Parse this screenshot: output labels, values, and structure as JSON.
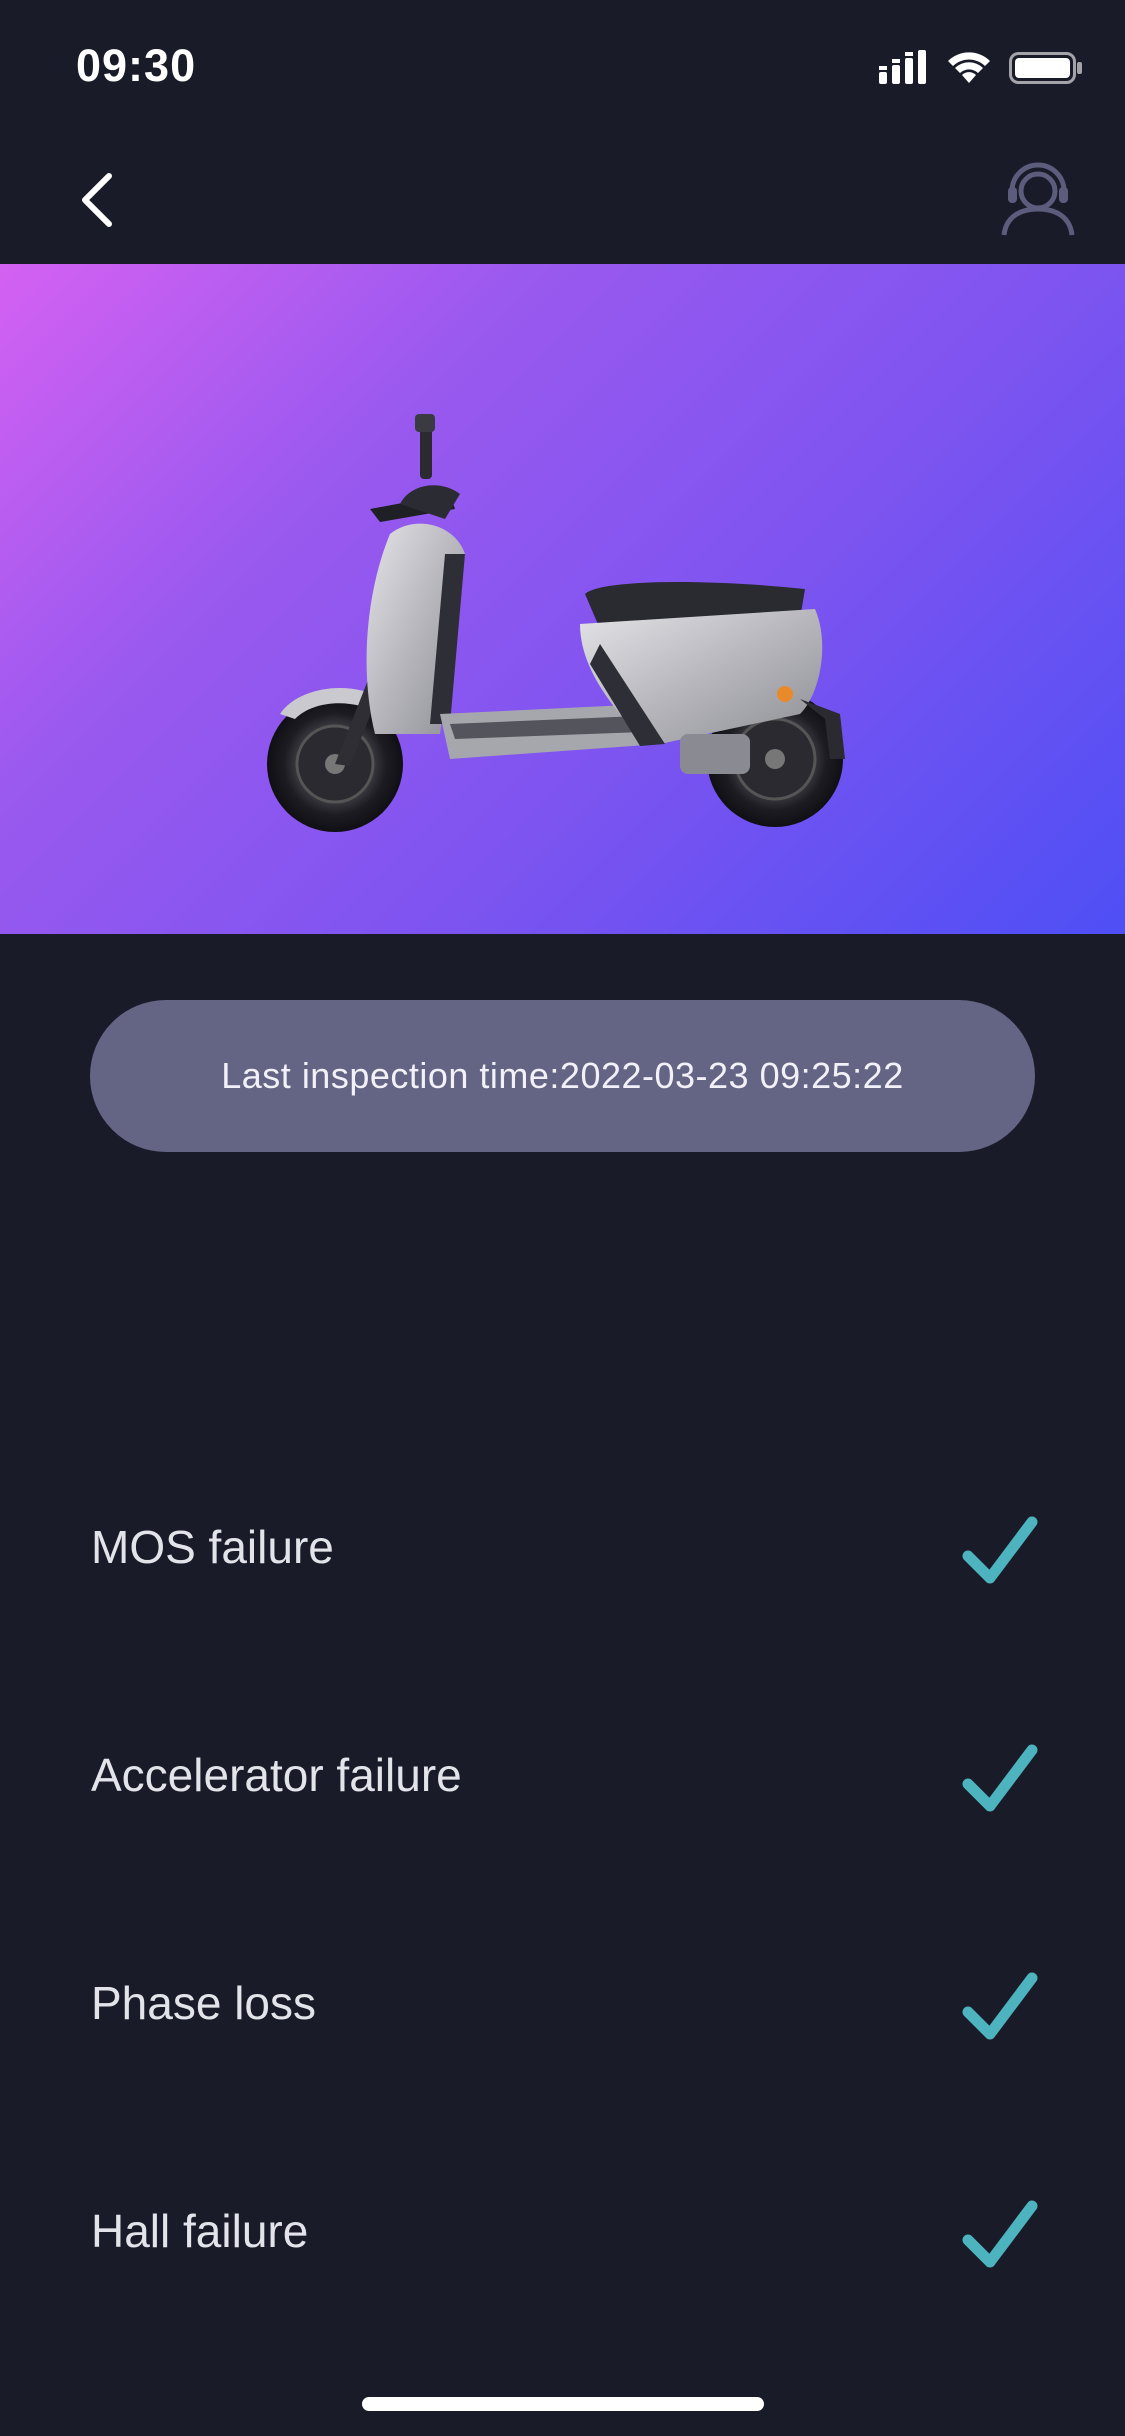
{
  "status_bar": {
    "time": "09:30",
    "icons": [
      "cellular-signal-icon",
      "wifi-icon",
      "battery-icon"
    ]
  },
  "nav": {
    "back_icon": "chevron-left-icon",
    "support_icon": "headset-support-icon"
  },
  "hero": {
    "image": "scooter-image",
    "gradient": [
      "#d461f2",
      "#4e4ff5"
    ]
  },
  "inspection": {
    "text": "Last inspection time:2022-03-23 09:25:22"
  },
  "checks": [
    {
      "label": "MOS failure",
      "status": "ok"
    },
    {
      "label": "Accelerator failure",
      "status": "ok"
    },
    {
      "label": "Phase loss",
      "status": "ok"
    },
    {
      "label": "Hall failure",
      "status": "ok"
    }
  ],
  "colors": {
    "background": "#1a1b29",
    "pill": "#646485",
    "check": "#4db3bf"
  }
}
